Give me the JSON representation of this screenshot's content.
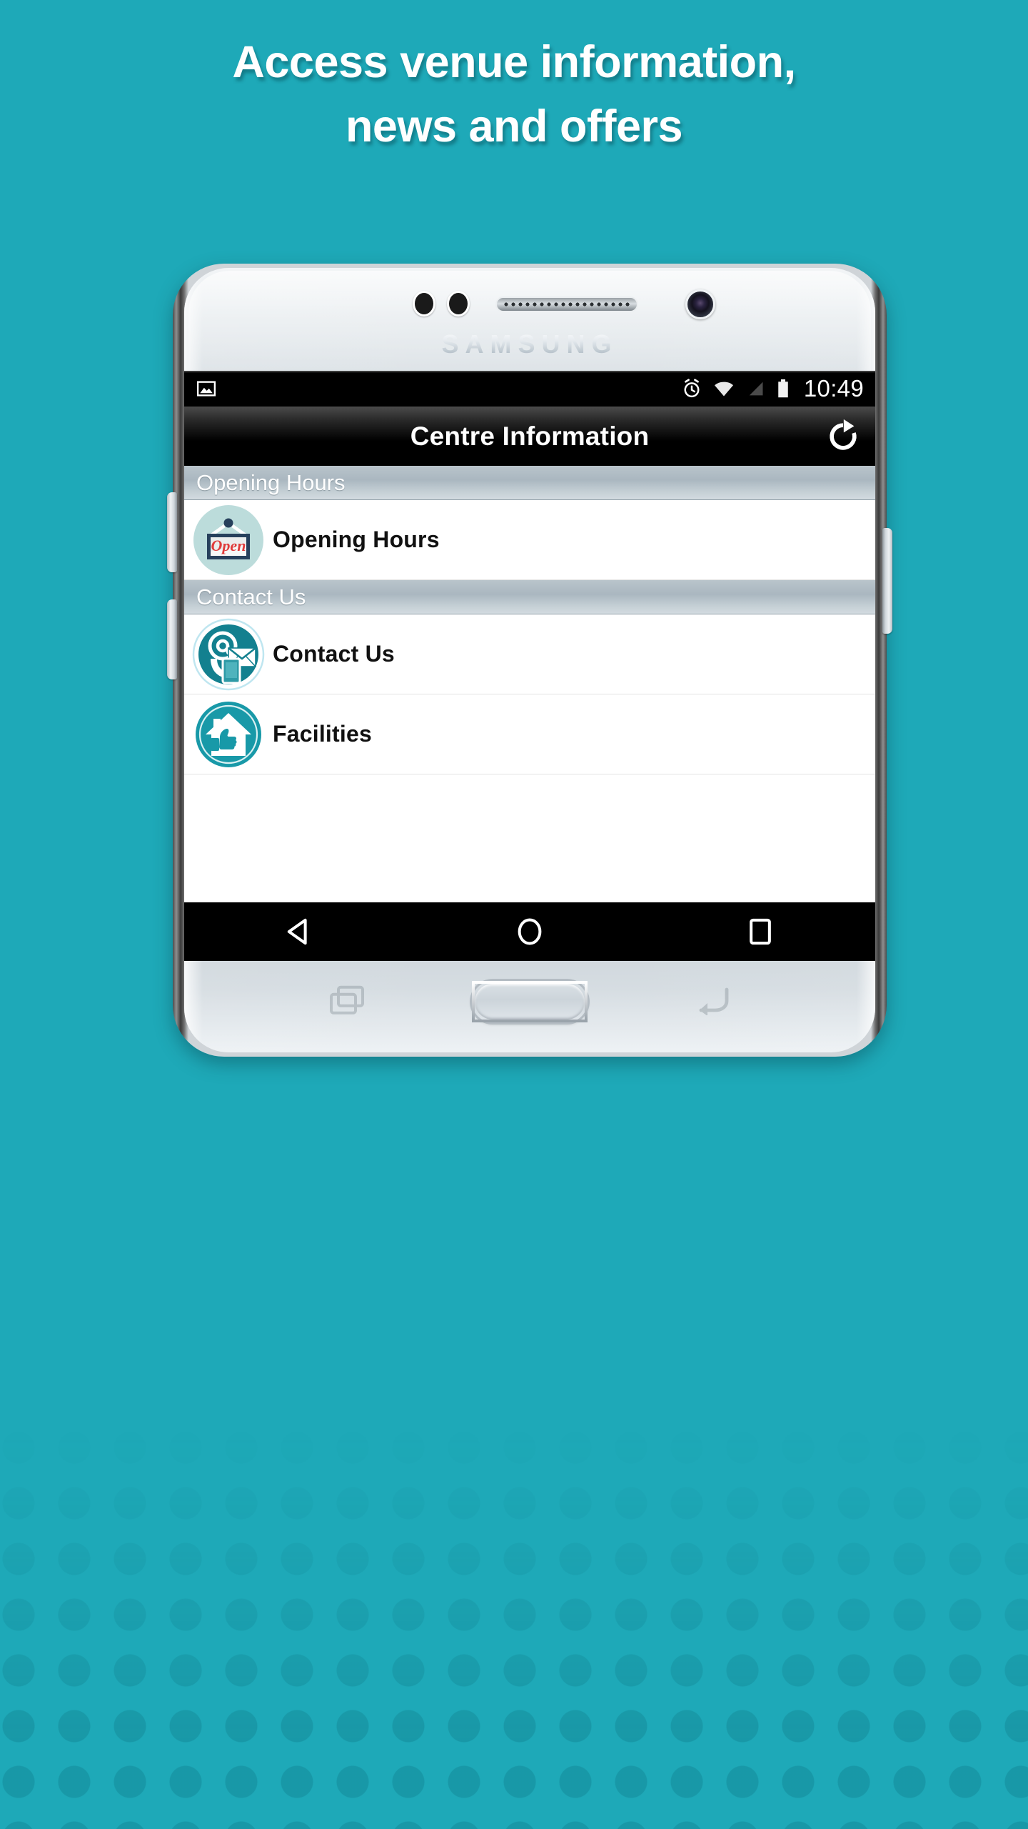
{
  "headline": {
    "line1": "Access venue information,",
    "line2": "news and offers"
  },
  "theme": {
    "background": "#1ea9b8",
    "dot_pattern": "#1a8fa0",
    "accent_teal": "#1899a8",
    "icon_teal_dark": "#13808f",
    "icon_teal_light": "#b7dcdc",
    "sign_navy": "#27405c",
    "sign_red": "#e03b3b",
    "section_header_text": "#ffffff"
  },
  "phone": {
    "brand": "SAMSUNG",
    "hardware": {
      "sensor_left": "proximity-sensor",
      "sensor_right": "light-sensor",
      "earpiece": "earpiece-speaker",
      "front_camera": "front-camera",
      "home_button": "home-button",
      "recents_key": "recents-key",
      "back_key": "back-key",
      "volume_up": "volume-up-button",
      "volume_down": "volume-down-button",
      "power": "power-button"
    }
  },
  "status_bar": {
    "time": "10:49",
    "icons_left": [
      "image-icon"
    ],
    "icons_right": [
      "alarm-icon",
      "wifi-icon",
      "signal-icon",
      "battery-icon"
    ]
  },
  "title_bar": {
    "title": "Centre Information",
    "refresh_icon": "refresh-icon"
  },
  "sections": [
    {
      "header": "Opening Hours",
      "rows": [
        {
          "label": "Opening Hours",
          "icon": "open-sign-icon",
          "sign_text": "Open"
        }
      ]
    },
    {
      "header": "Contact Us",
      "rows": [
        {
          "label": "Contact Us",
          "icon": "contact-at-envelope-phone-icon"
        },
        {
          "label": "Facilities",
          "icon": "house-thumbs-up-icon"
        }
      ]
    }
  ],
  "nav_bar": {
    "back": "back-triangle-icon",
    "home": "home-circle-icon",
    "recents": "recents-square-icon"
  }
}
